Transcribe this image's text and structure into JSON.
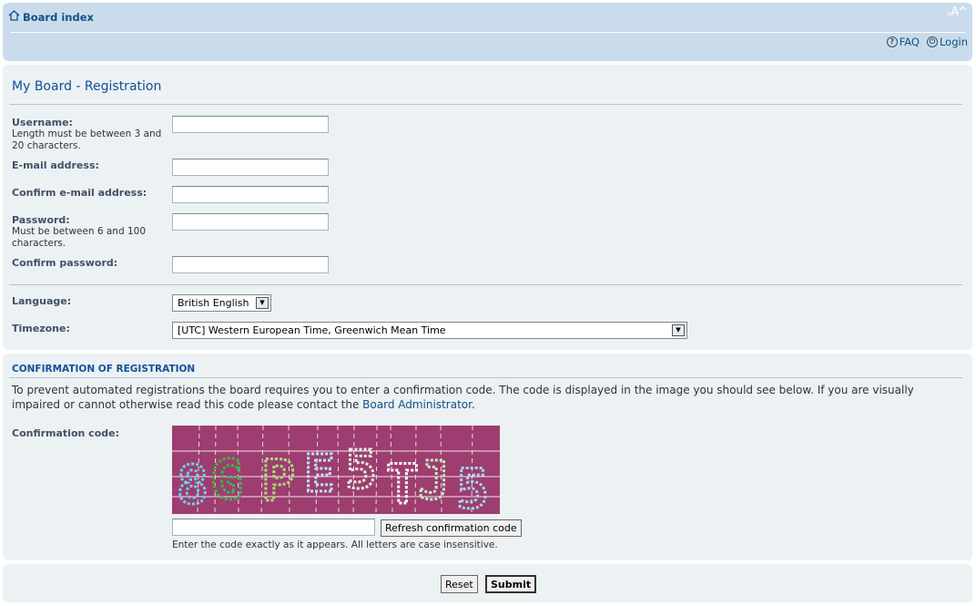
{
  "header": {
    "board_index": "Board index",
    "font_size_control": "ᵥA^",
    "faq": "FAQ",
    "login": "Login",
    "faq_icon_glyph": "?",
    "login_icon_glyph": "⏻"
  },
  "registration": {
    "title": "My Board - Registration",
    "username_label": "Username:",
    "username_hint": "Length must be between 3 and 20 characters.",
    "email_label": "E-mail address:",
    "confirm_email_label": "Confirm e-mail address:",
    "password_label": "Password:",
    "password_hint": "Must be between 6 and 100 characters.",
    "confirm_password_label": "Confirm password:",
    "language_label": "Language:",
    "language_value": "British English",
    "timezone_label": "Timezone:",
    "timezone_value": "[UTC] Western European Time, Greenwich Mean Time"
  },
  "confirmation": {
    "heading": "Confirmation of registration",
    "text_before_link": "To prevent automated registrations the board requires you to enter a confirmation code. The code is displayed in the image you should see below. If you are visually impaired or cannot otherwise read this code please contact the ",
    "admin_link": "Board Administrator",
    "text_after_link": ".",
    "code_label": "Confirmation code:",
    "captcha_text": "8GPE5TJ5",
    "refresh_button": "Refresh confirmation code",
    "code_hint": "Enter the code exactly as it appears. All letters are case insensitive."
  },
  "actions": {
    "reset": "Reset",
    "submit": "Submit"
  },
  "colors": {
    "header_bg": "#cadceb",
    "panel_bg": "#ecf1f3",
    "link": "#105289",
    "title": "#115098",
    "captcha_bg": "#9e3d6f"
  }
}
